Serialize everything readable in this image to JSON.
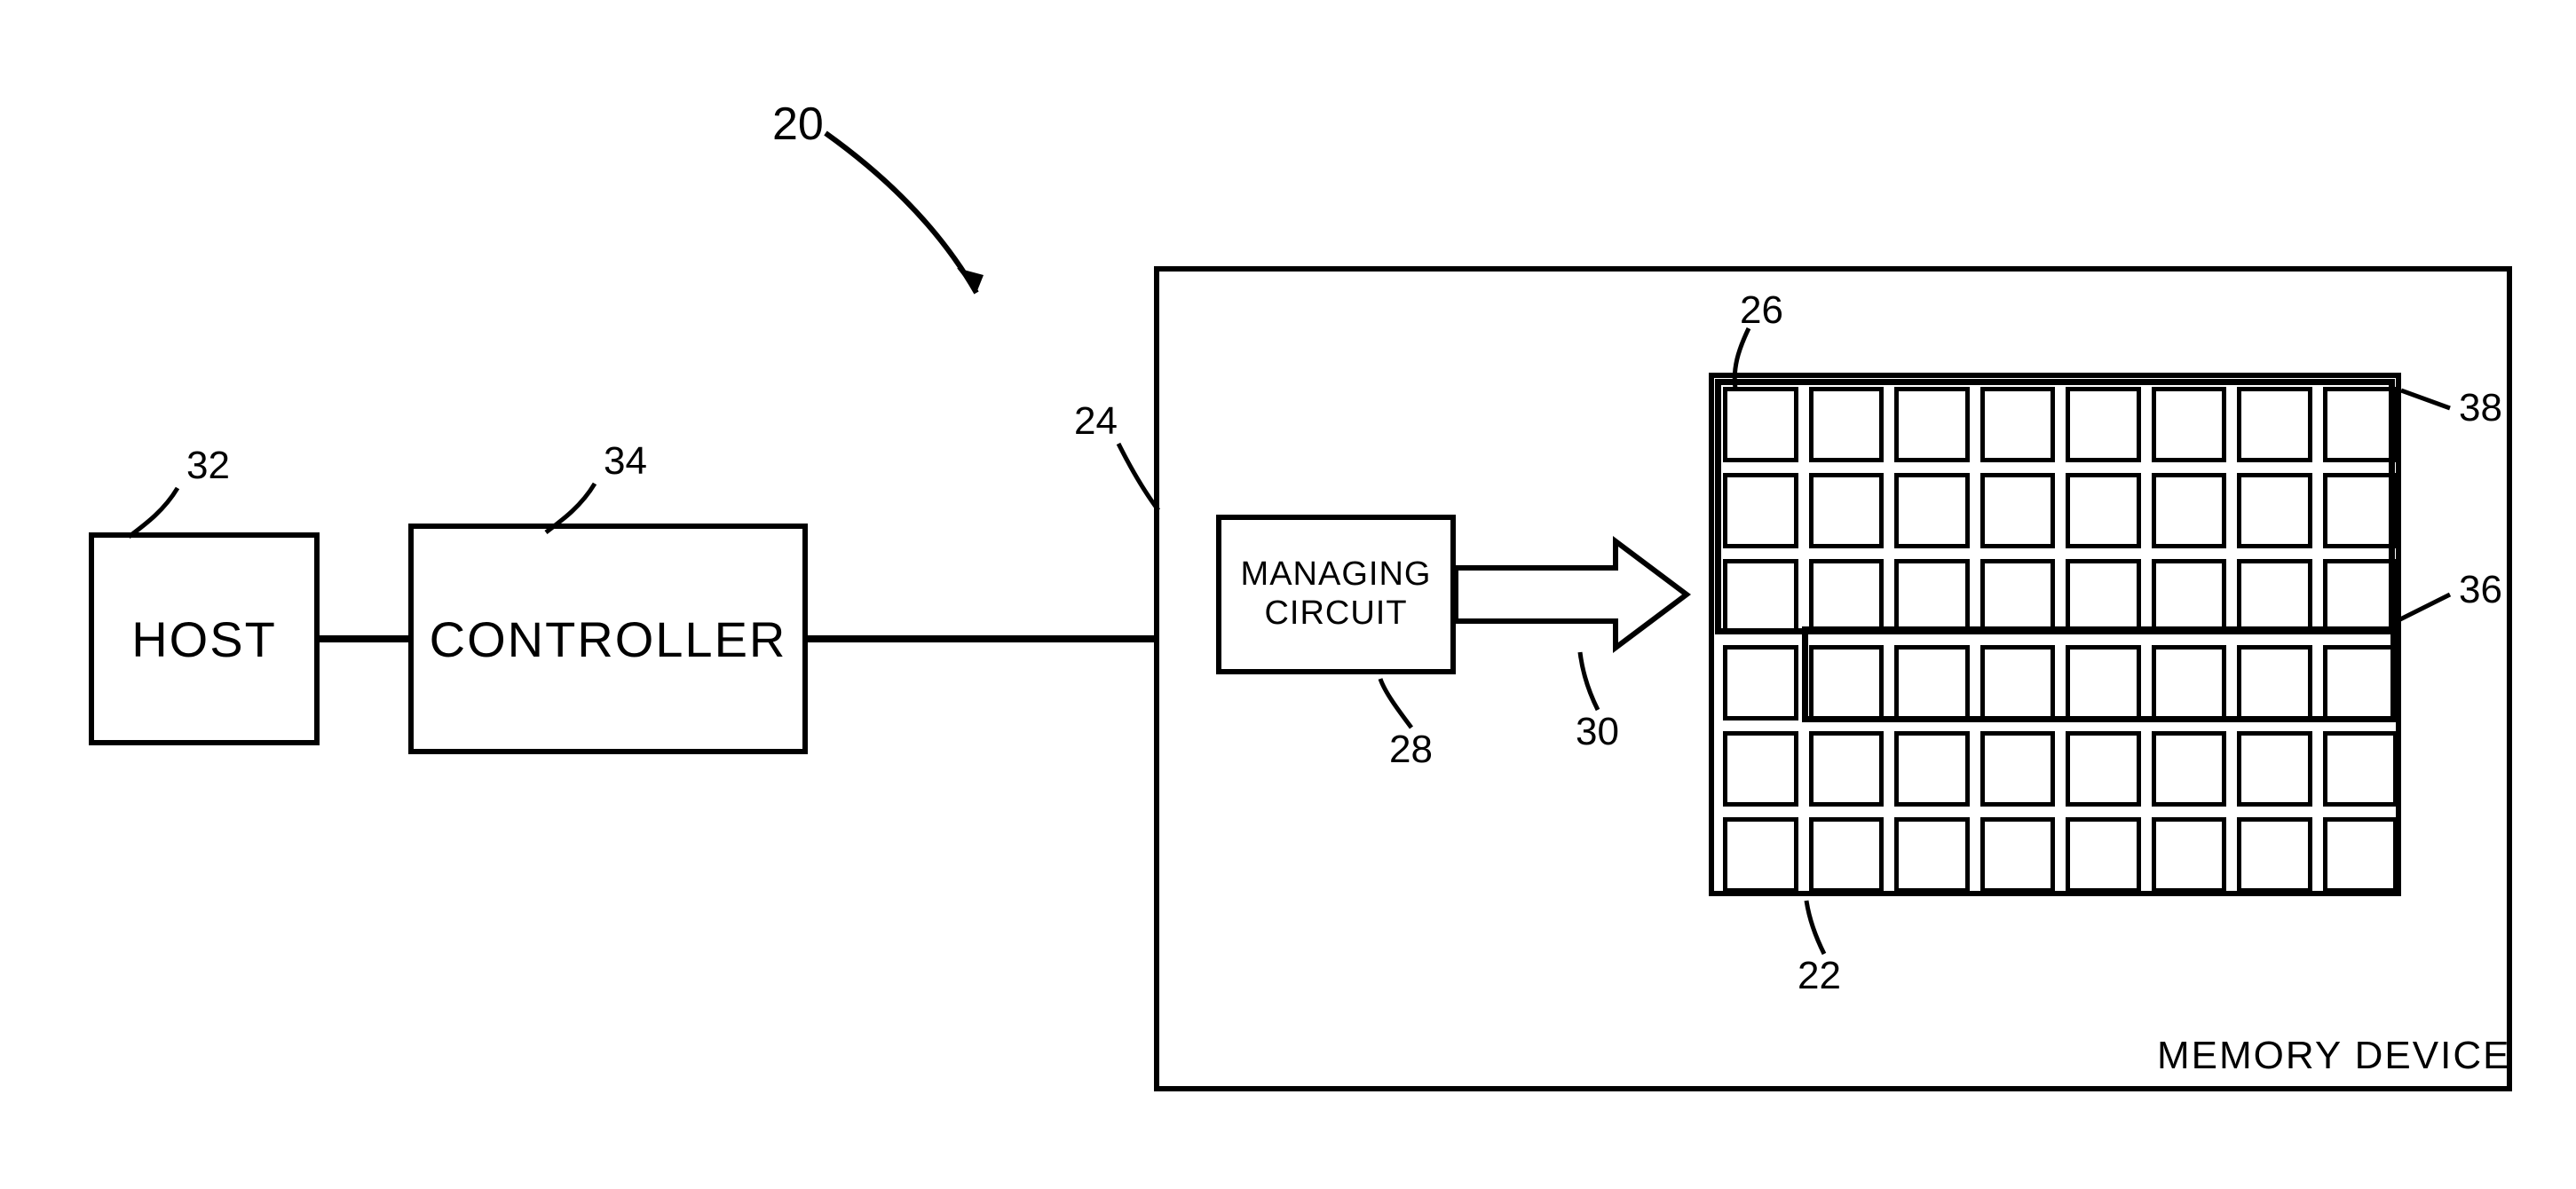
{
  "labels": {
    "system_ref": "20",
    "host_ref": "32",
    "controller_ref": "34",
    "device_ref": "24",
    "managing_ref": "28",
    "arrow_ref": "30",
    "array_ref": "22",
    "cell_ref": "26",
    "region_upper_ref": "38",
    "region_lower_ref": "36"
  },
  "blocks": {
    "host": "HOST",
    "controller": "CONTROLLER",
    "managing_line1": "MANAGING",
    "managing_line2": "CIRCUIT",
    "device": "MEMORY DEVICE"
  },
  "array": {
    "rows": 6,
    "cols": 8
  }
}
